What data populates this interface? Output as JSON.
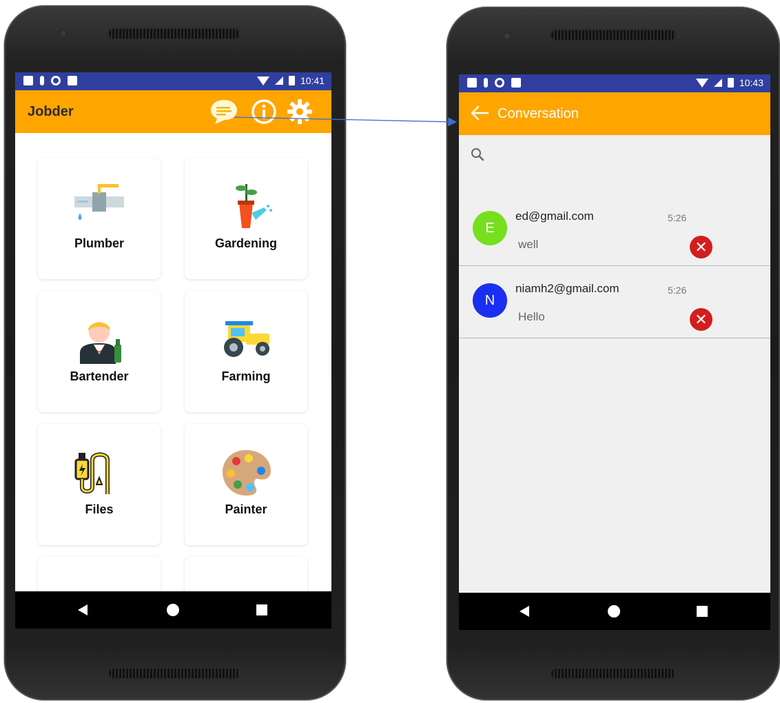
{
  "left": {
    "status_time": "10:41",
    "app_title": "Jobder",
    "header_icons": [
      "chat-bubble-icon",
      "info-icon",
      "gear-icon"
    ],
    "tiles": [
      {
        "label": "Plumber",
        "icon": "faucet-pipe-icon"
      },
      {
        "label": "Gardening",
        "icon": "plant-watering-can-icon"
      },
      {
        "label": "Bartender",
        "icon": "bartender-icon"
      },
      {
        "label": "Farming",
        "icon": "tractor-icon"
      },
      {
        "label": "Files",
        "icon": "electric-cable-icon"
      },
      {
        "label": "Painter",
        "icon": "paint-palette-icon"
      }
    ]
  },
  "right": {
    "status_time": "10:43",
    "title": "Conversation",
    "conversations": [
      {
        "initial": "E",
        "email": "ed@gmail.com",
        "time": "5:26",
        "message": "well",
        "avatar_color": "#76e01f"
      },
      {
        "initial": "N",
        "email": "niamh2@gmail.com",
        "time": "5:26",
        "message": "Hello",
        "avatar_color": "#1a2ff0"
      }
    ]
  },
  "colors": {
    "status_bar": "#303f9f",
    "app_bar": "#ffa500",
    "delete": "#d41d1d",
    "arrow": "#3a6fd0"
  }
}
